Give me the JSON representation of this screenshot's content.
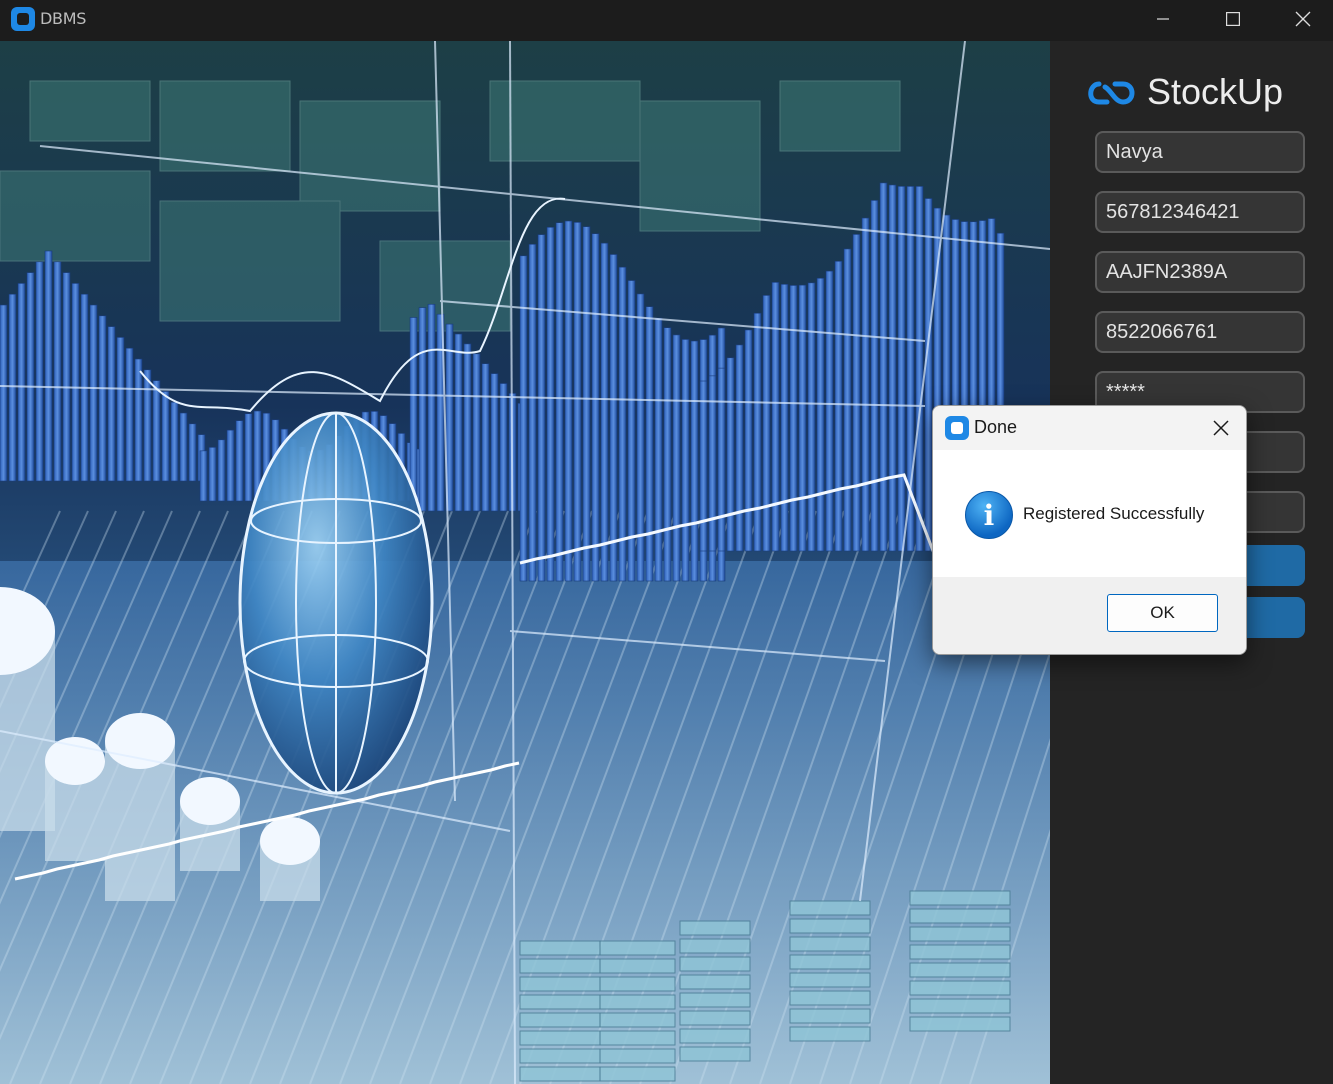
{
  "window": {
    "title": "DBMS",
    "controls": {
      "minimize_icon": "minimize-icon",
      "maximize_icon": "maximize-icon",
      "close_icon": "close-icon"
    }
  },
  "hero": {
    "image": "financial-stock-chart-globe-illustration"
  },
  "brand": {
    "name": "StockUp",
    "logo_icon": "infinity-cloud-logo",
    "accent": "#1e88e5"
  },
  "form": {
    "fields": [
      {
        "value": "Navya"
      },
      {
        "value": "567812346421"
      },
      {
        "value": "AAJFN2389A"
      },
      {
        "value": "8522066761"
      },
      {
        "value": "*****"
      },
      {
        "value": ""
      },
      {
        "value": ""
      }
    ],
    "button_color": "#1f6aa5"
  },
  "dialog": {
    "title": "Done",
    "icon": "info-icon",
    "message": "Registered Successfully",
    "ok_label": "OK"
  }
}
